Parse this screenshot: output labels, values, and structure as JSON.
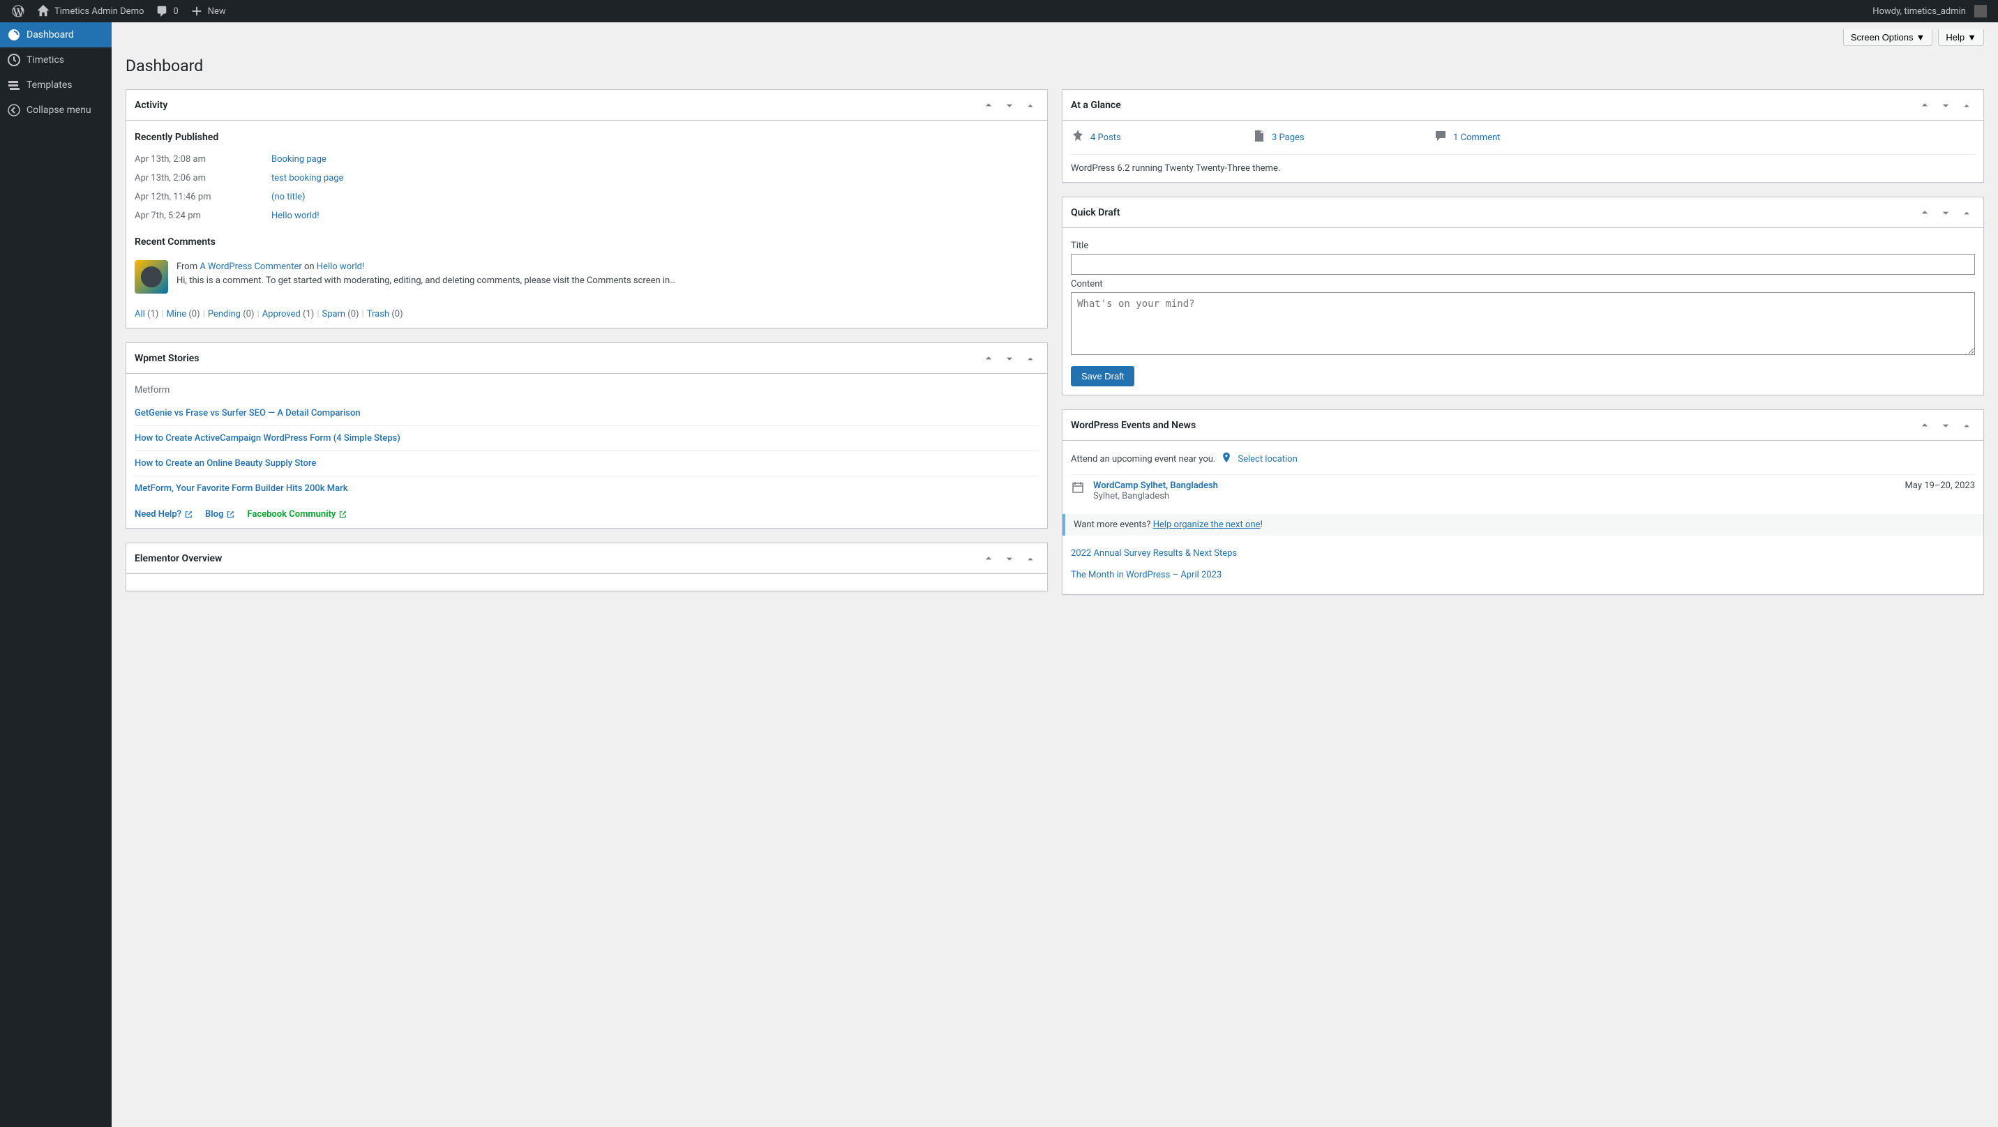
{
  "adminbar": {
    "site_name": "Timetics Admin Demo",
    "comments_count": "0",
    "new_label": "New",
    "howdy": "Howdy, timetics_admin"
  },
  "sidebar": {
    "items": [
      {
        "label": "Dashboard"
      },
      {
        "label": "Timetics"
      },
      {
        "label": "Templates"
      },
      {
        "label": "Collapse menu"
      }
    ]
  },
  "top": {
    "screen_options": "Screen Options",
    "help": "Help",
    "page_title": "Dashboard"
  },
  "activity": {
    "title": "Activity",
    "recently_published": "Recently Published",
    "posts": [
      {
        "date": "Apr 13th, 2:08 am",
        "title": "Booking page"
      },
      {
        "date": "Apr 13th, 2:06 am",
        "title": "test booking page"
      },
      {
        "date": "Apr 12th, 11:46 pm",
        "title": "(no title)"
      },
      {
        "date": "Apr 7th, 5:24 pm",
        "title": "Hello world!"
      }
    ],
    "recent_comments": "Recent Comments",
    "comment": {
      "from_label": "From ",
      "author": "A WordPress Commenter",
      "on_label": " on ",
      "post": "Hello world!",
      "text": "Hi, this is a comment. To get started with moderating, editing, and deleting comments, please visit the Comments screen in…"
    },
    "filters": [
      {
        "label": "All",
        "count": "(1)"
      },
      {
        "label": "Mine",
        "count": "(0)"
      },
      {
        "label": "Pending",
        "count": "(0)"
      },
      {
        "label": "Approved",
        "count": "(1)"
      },
      {
        "label": "Spam",
        "count": "(0)"
      },
      {
        "label": "Trash",
        "count": "(0)"
      }
    ]
  },
  "wpmet": {
    "title": "Wpmet Stories",
    "category": "Metform",
    "stories": [
      "GetGenie vs Frase vs Surfer SEO — A Detail Comparison",
      "How to Create ActiveCampaign WordPress Form (4 Simple Steps)",
      "How to Create an Online Beauty Supply Store",
      "MetForm, Your Favorite Form Builder Hits 200k Mark"
    ],
    "help_links": {
      "need_help": "Need Help?",
      "blog": "Blog",
      "facebook": "Facebook Community"
    }
  },
  "elementor": {
    "title": "Elementor Overview"
  },
  "glance": {
    "title": "At a Glance",
    "posts": "4 Posts",
    "pages": "3 Pages",
    "comments": "1 Comment",
    "theme": "WordPress 6.2 running Twenty Twenty-Three theme."
  },
  "quickdraft": {
    "title": "Quick Draft",
    "title_label": "Title",
    "content_label": "Content",
    "content_placeholder": "What's on your mind?",
    "save": "Save Draft"
  },
  "events": {
    "title": "WordPress Events and News",
    "attend": "Attend an upcoming event near you.",
    "select_location": "Select location",
    "event": {
      "name": "WordCamp Sylhet, Bangladesh",
      "location": "Sylhet, Bangladesh",
      "date": "May 19–20, 2023"
    },
    "want_more": "Want more events? ",
    "help_organize": "Help organize the next one",
    "bang": "!",
    "news": [
      "2022 Annual Survey Results & Next Steps",
      "The Month in WordPress – April 2023"
    ]
  }
}
